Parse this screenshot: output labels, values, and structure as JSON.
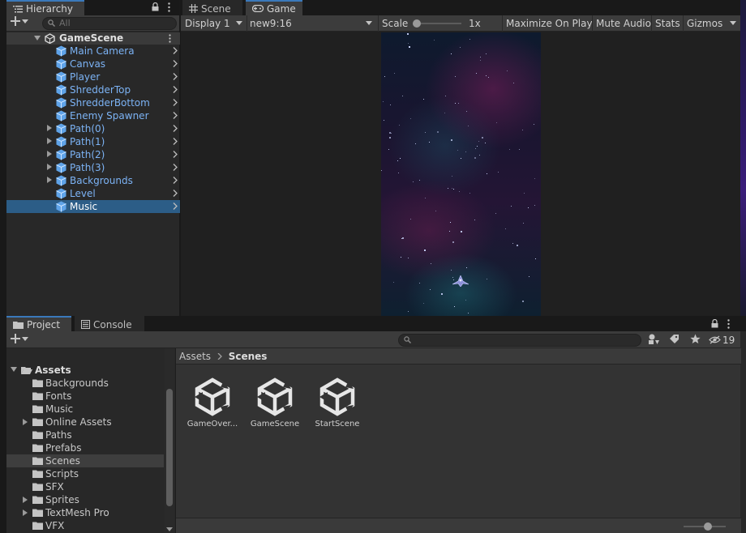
{
  "hierarchy": {
    "tab_label": "Hierarchy",
    "search_placeholder": "All",
    "scene_name": "GameScene",
    "items": [
      {
        "label": "Main Camera",
        "foldout": false,
        "selected": false
      },
      {
        "label": "Canvas",
        "foldout": false,
        "selected": false
      },
      {
        "label": "Player",
        "foldout": false,
        "selected": false
      },
      {
        "label": "ShredderTop",
        "foldout": false,
        "selected": false
      },
      {
        "label": "ShredderBottom",
        "foldout": false,
        "selected": false
      },
      {
        "label": "Enemy Spawner",
        "foldout": false,
        "selected": false
      },
      {
        "label": "Path(0)",
        "foldout": true,
        "selected": false
      },
      {
        "label": "Path(1)",
        "foldout": true,
        "selected": false
      },
      {
        "label": "Path(2)",
        "foldout": true,
        "selected": false
      },
      {
        "label": "Path(3)",
        "foldout": true,
        "selected": false
      },
      {
        "label": "Backgrounds",
        "foldout": true,
        "selected": false
      },
      {
        "label": "Level",
        "foldout": false,
        "selected": false
      },
      {
        "label": "Music",
        "foldout": false,
        "selected": true
      }
    ]
  },
  "game_view": {
    "tabs": [
      {
        "label": "Scene",
        "active": false
      },
      {
        "label": "Game",
        "active": true
      }
    ],
    "display": "Display 1",
    "aspect": "new9:16",
    "scale_label": "Scale",
    "scale_value": "1x",
    "buttons": {
      "maximize": "Maximize On Play",
      "mute": "Mute Audio",
      "stats": "Stats",
      "gizmos": "Gizmos"
    }
  },
  "project": {
    "tabs": [
      {
        "label": "Project",
        "active": true
      },
      {
        "label": "Console",
        "active": false
      }
    ],
    "hidden_count": "19",
    "breadcrumb": {
      "root": "Assets",
      "current": "Scenes"
    },
    "tree": {
      "root": "Assets",
      "folders": [
        {
          "label": "Backgrounds",
          "foldout": false,
          "selected": false
        },
        {
          "label": "Fonts",
          "foldout": false,
          "selected": false
        },
        {
          "label": "Music",
          "foldout": false,
          "selected": false
        },
        {
          "label": "Online Assets",
          "foldout": true,
          "selected": false
        },
        {
          "label": "Paths",
          "foldout": false,
          "selected": false
        },
        {
          "label": "Prefabs",
          "foldout": false,
          "selected": false
        },
        {
          "label": "Scenes",
          "foldout": false,
          "selected": true
        },
        {
          "label": "Scripts",
          "foldout": false,
          "selected": false
        },
        {
          "label": "SFX",
          "foldout": false,
          "selected": false
        },
        {
          "label": "Sprites",
          "foldout": true,
          "selected": false
        },
        {
          "label": "TextMesh Pro",
          "foldout": true,
          "selected": false
        },
        {
          "label": "VFX",
          "foldout": false,
          "selected": false
        }
      ]
    },
    "assets": [
      {
        "label": "GameOver...",
        "icon": "unity-scene-icon"
      },
      {
        "label": "GameScene",
        "icon": "unity-scene-icon"
      },
      {
        "label": "StartScene",
        "icon": "unity-scene-icon"
      }
    ]
  },
  "colors": {
    "accent": "#3a79bb",
    "selection": "#2c5d87",
    "prefab_blue": "#7cb3f5"
  }
}
